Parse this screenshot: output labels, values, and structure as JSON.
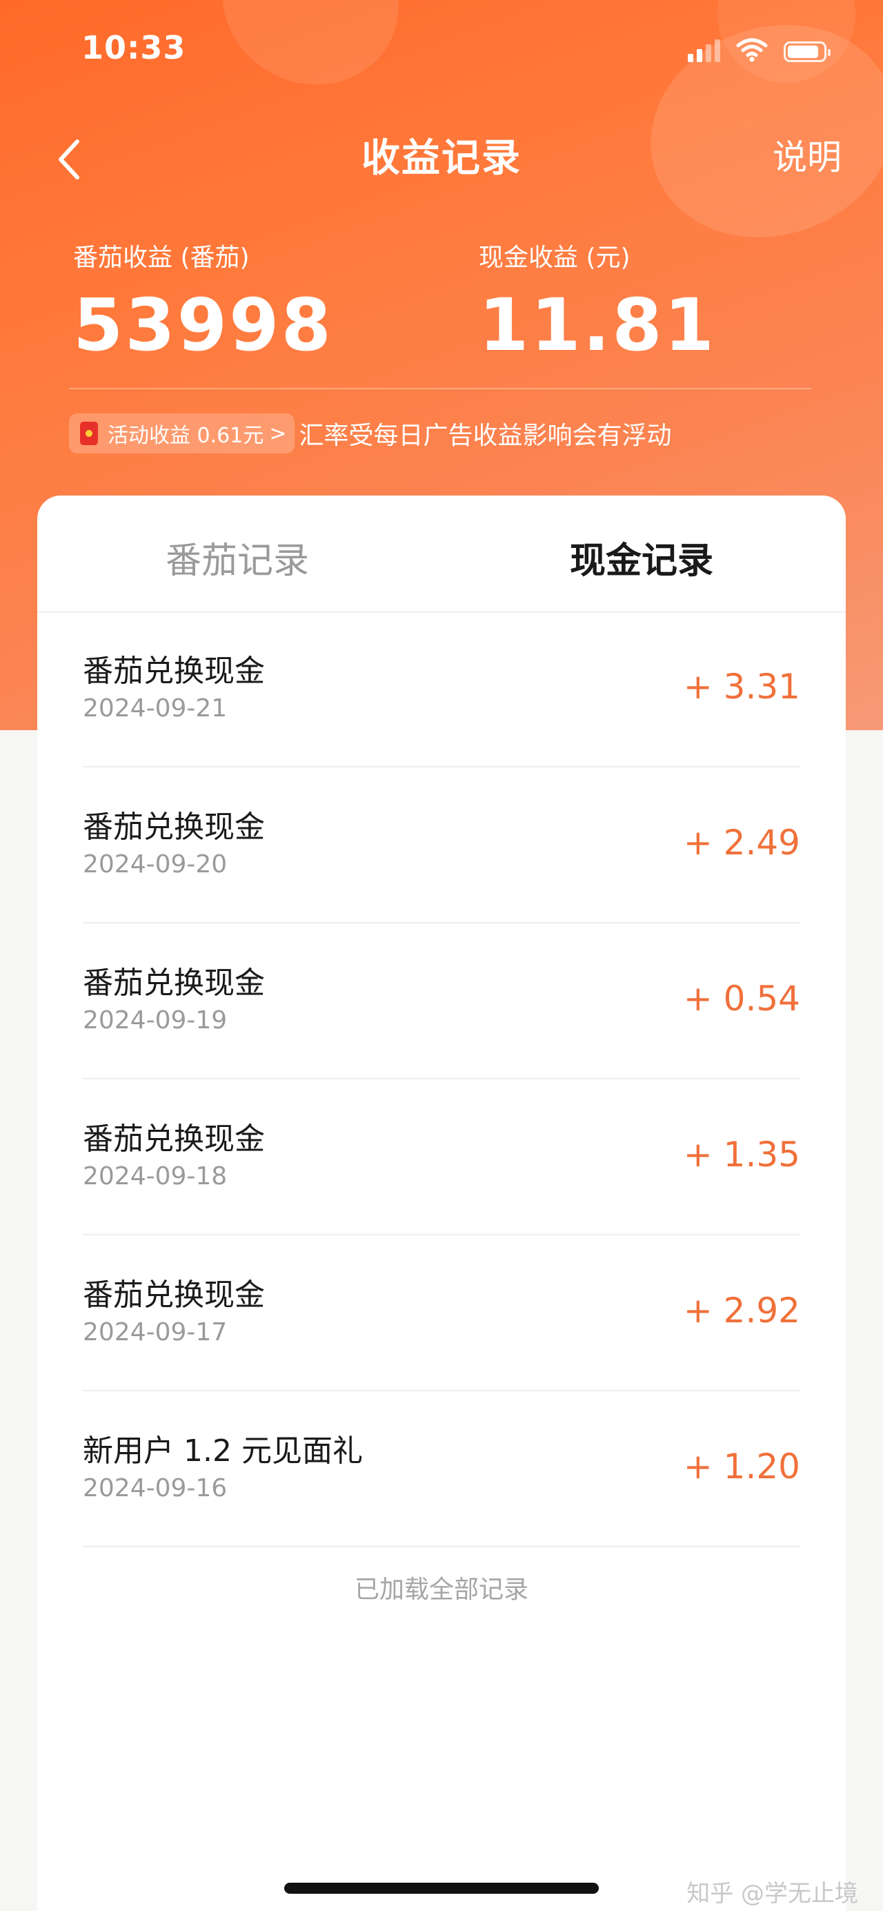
{
  "status_bar": {
    "time": "10:33",
    "icons": [
      "signal-icon",
      "wifi-icon",
      "battery-icon"
    ]
  },
  "nav": {
    "back_icon": "chevron-left-icon",
    "title": "收益记录",
    "explain": "说明"
  },
  "summary": {
    "tomato_label": "番茄收益 (番茄)",
    "tomato_value": "53998",
    "cash_label": "现金收益 (元)",
    "cash_value": "11.81"
  },
  "activity": {
    "pill_text": "活动收益 0.61元",
    "pill_chevron": ">",
    "note": "汇率受每日广告收益影响会有浮动"
  },
  "tabs": [
    {
      "label": "番茄记录",
      "active": false
    },
    {
      "label": "现金记录",
      "active": true
    }
  ],
  "records": [
    {
      "title": "番茄兑换现金",
      "date": "2024-09-21",
      "amount": "+ 3.31"
    },
    {
      "title": "番茄兑换现金",
      "date": "2024-09-20",
      "amount": "+ 2.49"
    },
    {
      "title": "番茄兑换现金",
      "date": "2024-09-19",
      "amount": "+ 0.54"
    },
    {
      "title": "番茄兑换现金",
      "date": "2024-09-18",
      "amount": "+ 1.35"
    },
    {
      "title": "番茄兑换现金",
      "date": "2024-09-17",
      "amount": "+ 2.92"
    },
    {
      "title": "新用户 1.2 元见面礼",
      "date": "2024-09-16",
      "amount": "+ 1.20"
    }
  ],
  "footer": {
    "loaded_note": "已加载全部记录",
    "watermark": "知乎 @学无止境"
  },
  "colors": {
    "header_orange": "#ff6a2a",
    "amount_orange": "#f0703a",
    "background": "#f6f6f4"
  }
}
